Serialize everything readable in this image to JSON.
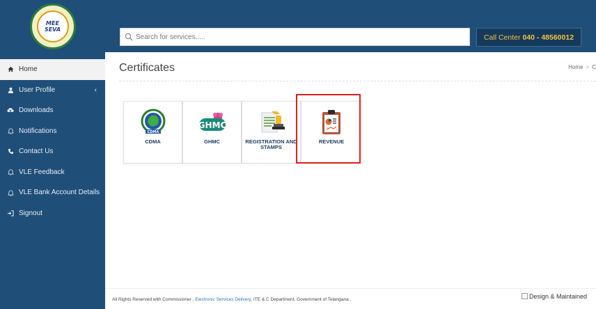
{
  "logo": {
    "line1": "MEE",
    "line2": "SEVA"
  },
  "sidebar": {
    "items": [
      {
        "label": "Home",
        "icon": "home-icon",
        "active": true
      },
      {
        "label": "User Profile",
        "icon": "user-icon",
        "caret": "‹"
      },
      {
        "label": "Downloads",
        "icon": "cloud-download-icon"
      },
      {
        "label": "Notifications",
        "icon": "bell-icon"
      },
      {
        "label": "Contact Us",
        "icon": "phone-icon"
      },
      {
        "label": "VLE Feedback",
        "icon": "bell-icon"
      },
      {
        "label": "VLE Bank Account Details",
        "icon": "bell-icon"
      },
      {
        "label": "Signout",
        "icon": "signout-icon"
      }
    ]
  },
  "topbar": {
    "search_placeholder": "Search for services.....",
    "call_center_label": "Call Center",
    "call_center_number": "040 - 48560012"
  },
  "main": {
    "title": "Certificates",
    "breadcrumb": [
      "Home",
      "C"
    ]
  },
  "tiles": [
    {
      "label": "CDMA",
      "icon": "cdma-logo-icon"
    },
    {
      "label": "GHMC",
      "icon": "ghmc-logo-icon"
    },
    {
      "label": "REGISTRATION AND STAMPS",
      "icon": "registration-stamp-icon"
    },
    {
      "label": "REVENUE",
      "icon": "revenue-clipboard-icon"
    }
  ],
  "footer": {
    "prefix": "All Rights Reserved with Commissioner ,",
    "link": "Electronic Services Delivery",
    "suffix": ", ITE & C Department, Government of Telangana .",
    "image_alt": "Design & Maintained"
  },
  "colors": {
    "sidebar_bg": "#1f4e79",
    "call_center_text": "#f0c244",
    "highlight": "#e02020",
    "tile_label": "#1f3d66"
  }
}
